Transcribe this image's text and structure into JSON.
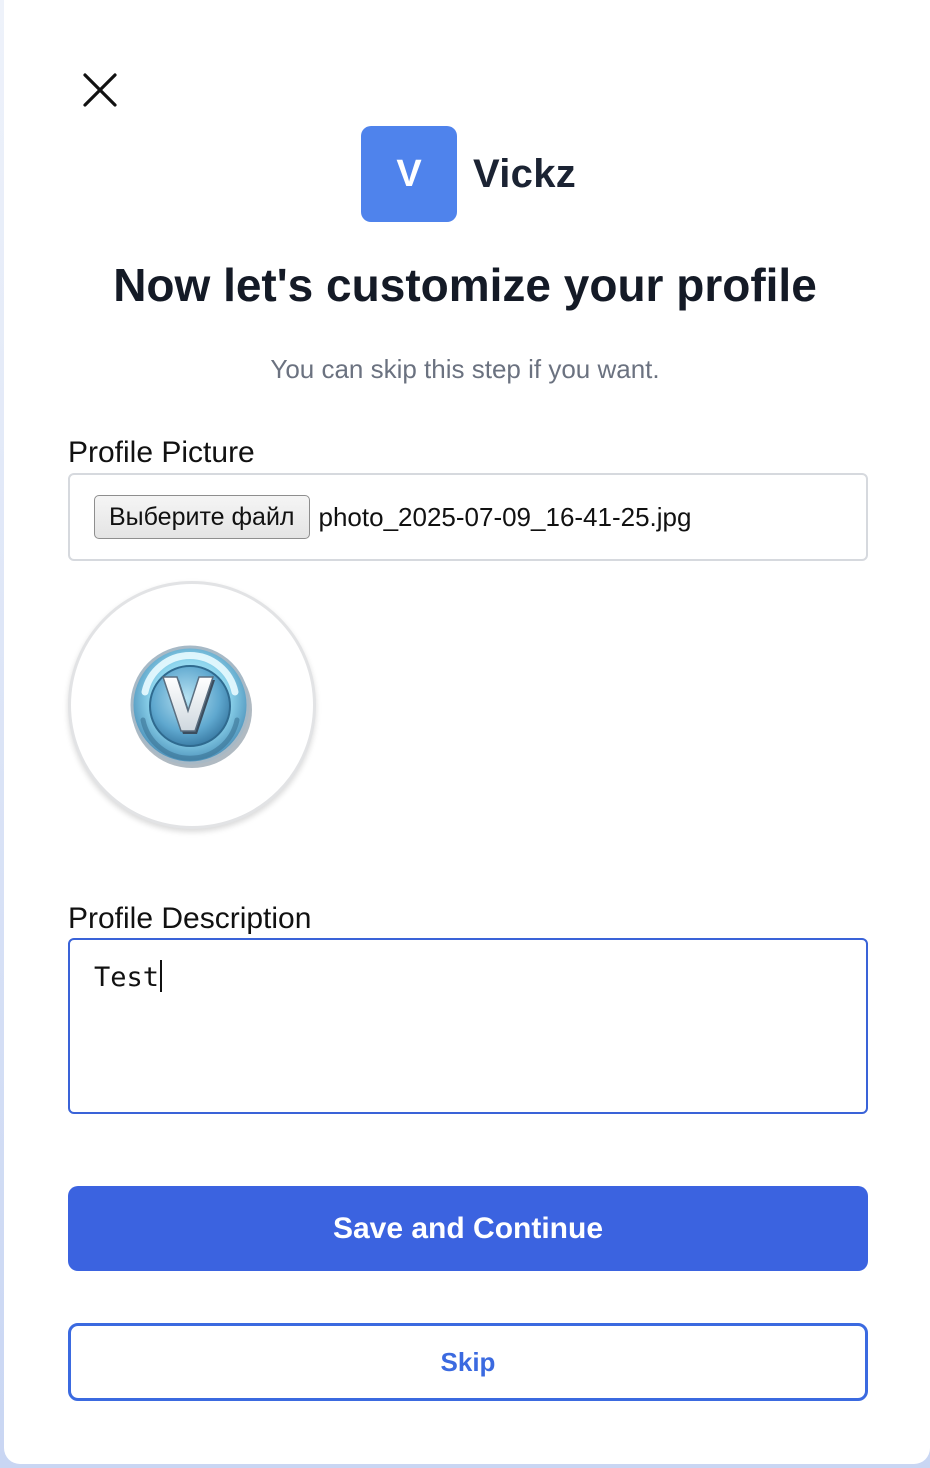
{
  "brand": {
    "logo_letter": "V",
    "name": "Vickz",
    "logo_color": "#4f83ec"
  },
  "header": {
    "title": "Now let's customize your profile",
    "subtitle": "You can skip this step if you want."
  },
  "profile_picture": {
    "label": "Profile Picture",
    "choose_file_label": "Выберите файл",
    "file_name": "photo_2025-07-09_16-41-25.jpg",
    "preview_icon": "v-bucks-coin-icon"
  },
  "profile_description": {
    "label": "Profile Description",
    "value": "Test"
  },
  "actions": {
    "save_label": "Save and Continue",
    "skip_label": "Skip",
    "primary_color": "#3b63e0"
  },
  "icons": {
    "close": "close-icon"
  }
}
